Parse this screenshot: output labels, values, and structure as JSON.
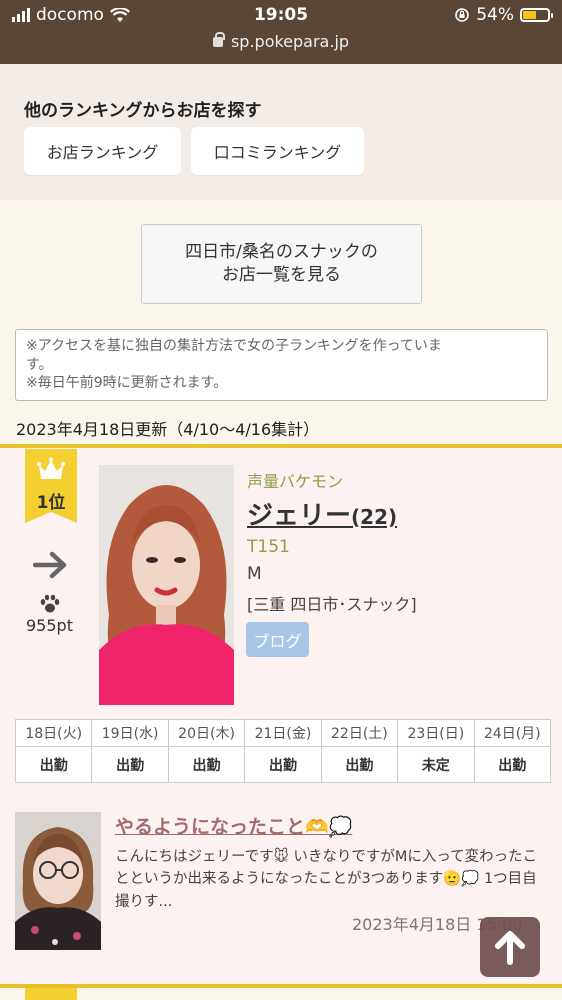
{
  "status_bar": {
    "carrier": "docomo",
    "time": "19:05",
    "battery": "54%",
    "battery_level": 0.54,
    "url": "sp.pokepara.jp"
  },
  "other_ranking": {
    "heading": "他のランキングからお店を探す",
    "buttons": [
      "お店ランキング",
      "口コミランキング"
    ]
  },
  "shop_list_button": {
    "line1": "四日市/桑名のスナックの",
    "line2": "お店一覧を見る"
  },
  "notice": {
    "line1": "※アクセスを基に独自の集計方法で女の子ランキングを作っていま",
    "line2": "す。",
    "line3": "※毎日午前9時に更新されます。"
  },
  "updated": "2023年4月18日更新（4/10〜4/16集計）",
  "entry": {
    "rank": "1位",
    "points": "955pt",
    "tag": "声量バケモン",
    "name": "ジェリー",
    "age": "(22)",
    "height": "T151",
    "cup": "M",
    "location": "[三重 四日市･スナック]",
    "blog_label": "ブログ",
    "schedule": {
      "days": [
        "18日(火)",
        "19日(水)",
        "20日(木)",
        "21日(金)",
        "22日(土)",
        "23日(日)",
        "24日(月)"
      ],
      "status": [
        "出勤",
        "出勤",
        "出勤",
        "出勤",
        "出勤",
        "未定",
        "出勤"
      ]
    },
    "post": {
      "title": "やるようになったこと🫶💭",
      "body": "こんにちはジェリーです🐭 いきなりですがMに入って変わったことというか出来るようになったことが3つあります🫡💭 1つ目自撮りす...",
      "date": "2023年4月18日 15:00"
    }
  },
  "colors": {
    "header_bg": "#5a4636",
    "gold": "#e8c12a",
    "tag_green": "#8da04a",
    "saturday": "#3fb6c9",
    "sunday": "#e58eb0",
    "blog_blue": "#a8c6e8"
  }
}
